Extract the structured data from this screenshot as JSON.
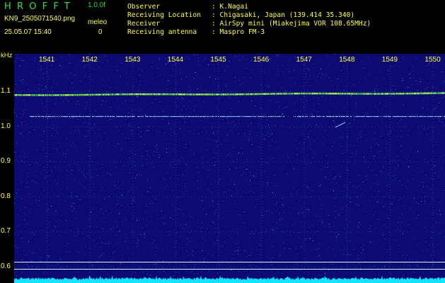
{
  "app": {
    "title": "HROFFT",
    "version": "1.0.0f",
    "filename": "KN9_2505071540.png",
    "datetime": "25.05.07 15:40",
    "meleo_label": "meleo",
    "meleo_value": "0"
  },
  "station_info": [
    {
      "label": "Observer",
      "value": ": K.Nagai"
    },
    {
      "label": "Receiving Location",
      "value": ": Chigasaki, Japan (139.414 35.340)"
    },
    {
      "label": "Receiver",
      "value": ": AirSpy mini (Miakejima VOR 108.65MHz)"
    },
    {
      "label": "Receiving antenna",
      "value": ": Maspro FM-3"
    }
  ],
  "spectrogram": {
    "unit": "kHz",
    "time_ticks": [
      "1541",
      "1542",
      "1543",
      "1544",
      "1545",
      "1546",
      "1547",
      "1548",
      "1549",
      "1550"
    ],
    "freq_ticks": [
      "1.1",
      "1.0",
      "0.9",
      "0.8",
      "0.7",
      "0.6"
    ],
    "colors": {
      "background": "#0d0a72",
      "grid": "#2f63c8",
      "carrier": "#7ce63a",
      "carrier_core": "#e8ff7a",
      "secondary_line": "#9fe7ff",
      "reference_line": "#d9f4ff",
      "noise_floor": "#12e3ff",
      "text": "#ffff3a"
    }
  }
}
